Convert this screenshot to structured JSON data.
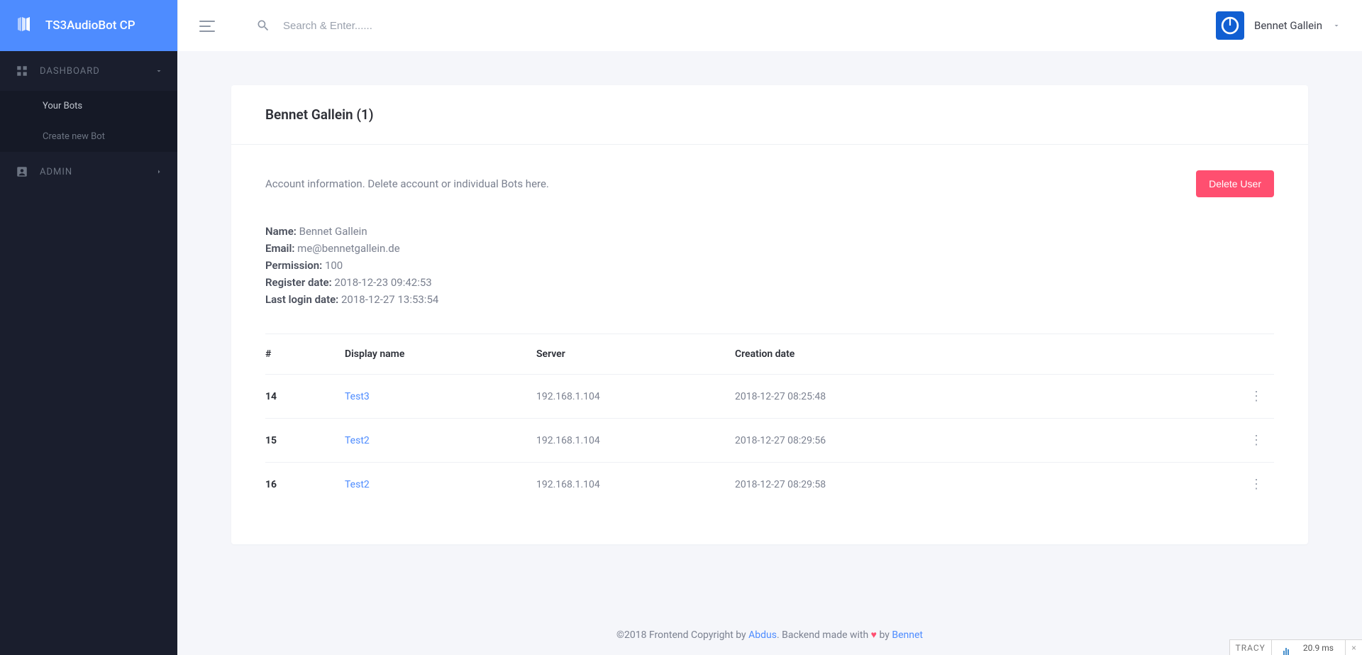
{
  "brand": "TS3AudioBot CP",
  "search": {
    "placeholder": "Search & Enter......"
  },
  "user": {
    "name": "Bennet Gallein"
  },
  "sidebar": {
    "dashboard_label": "DASHBOARD",
    "your_bots": "Your Bots",
    "create_bot": "Create new Bot",
    "admin_label": "ADMIN"
  },
  "page": {
    "title": "Bennet Gallein (1)",
    "subtitle": "Account information. Delete account or individual Bots here.",
    "delete_btn": "Delete User"
  },
  "account": {
    "name_label": "Name:",
    "name_value": "Bennet Gallein",
    "email_label": "Email:",
    "email_value": "me@bennetgallein.de",
    "permission_label": "Permission:",
    "permission_value": "100",
    "register_label": "Register date:",
    "register_value": "2018-12-23 09:42:53",
    "lastlogin_label": "Last login date:",
    "lastlogin_value": "2018-12-27 13:53:54"
  },
  "table": {
    "col_id": "#",
    "col_name": "Display name",
    "col_server": "Server",
    "col_date": "Creation date",
    "rows": [
      {
        "id": "14",
        "name": "Test3",
        "server": "192.168.1.104",
        "date": "2018-12-27 08:25:48"
      },
      {
        "id": "15",
        "name": "Test2",
        "server": "192.168.1.104",
        "date": "2018-12-27 08:29:56"
      },
      {
        "id": "16",
        "name": "Test2",
        "server": "192.168.1.104",
        "date": "2018-12-27 08:29:58"
      }
    ]
  },
  "footer": {
    "pre": "©2018 Frontend Copyright by ",
    "link1": "Abdus",
    "mid": ". Backend made with ",
    "heart": "♥",
    "by": " by ",
    "link2": "Bennet"
  },
  "tracy": {
    "label": "TRACY",
    "time": "20.9 ms",
    "close": "×"
  }
}
